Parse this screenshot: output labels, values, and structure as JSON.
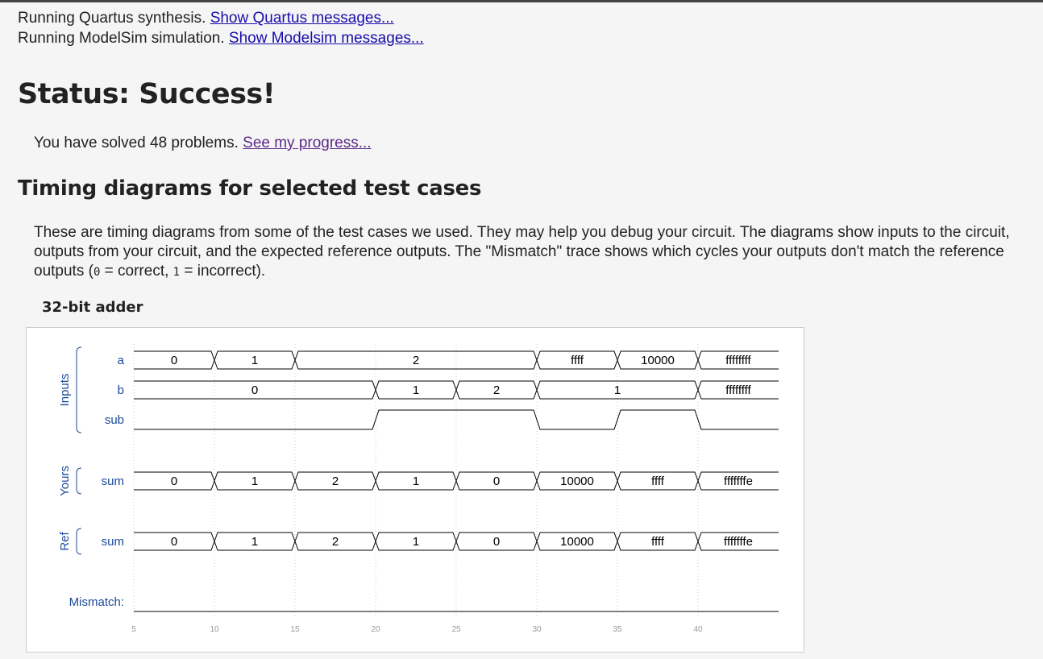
{
  "status_lines": [
    {
      "text": "Running Quartus synthesis. ",
      "link": "Show Quartus messages..."
    },
    {
      "text": "Running ModelSim simulation. ",
      "link": "Show Modelsim messages..."
    }
  ],
  "status_title": "Status: Success!",
  "progress": {
    "text": "You have solved 48 problems. ",
    "link": "See my progress..."
  },
  "section_title": "Timing diagrams for selected test cases",
  "description": {
    "part1": "These are timing diagrams from some of the test cases we used. They may help you debug your circuit. The diagrams show inputs to the circuit, outputs from your circuit, and the expected reference outputs. The \"Mismatch\" trace shows which cycles your outputs don't match the reference outputs (",
    "zero": "0",
    "part2": " = correct, ",
    "one": "1",
    "part3": " = incorrect)."
  },
  "diagram_title": "32-bit adder",
  "waveform": {
    "time_ticks": [
      5,
      10,
      15,
      20,
      25,
      30,
      35,
      40
    ],
    "time_range": [
      5,
      45
    ],
    "groups": [
      {
        "label": "Inputs",
        "signals": [
          "a",
          "b",
          "sub"
        ]
      },
      {
        "label": "Yours",
        "signals": [
          "sum"
        ]
      },
      {
        "label": "Ref",
        "signals": [
          "sum"
        ]
      }
    ],
    "mismatch_label": "Mismatch:",
    "colors": {
      "group_label": "#1a4a9a",
      "line": "#000000",
      "grid": "#cccccc"
    },
    "signals": [
      {
        "name": "a",
        "type": "bus",
        "segments": [
          {
            "start": 5,
            "end": 10,
            "value": "0"
          },
          {
            "start": 10,
            "end": 15,
            "value": "1"
          },
          {
            "start": 15,
            "end": 30,
            "value": "2"
          },
          {
            "start": 30,
            "end": 35,
            "value": "ffff"
          },
          {
            "start": 35,
            "end": 40,
            "value": "10000"
          },
          {
            "start": 40,
            "end": 45,
            "value": "ffffffff"
          }
        ]
      },
      {
        "name": "b",
        "type": "bus",
        "segments": [
          {
            "start": 5,
            "end": 20,
            "value": "0"
          },
          {
            "start": 20,
            "end": 25,
            "value": "1"
          },
          {
            "start": 25,
            "end": 30,
            "value": "2"
          },
          {
            "start": 30,
            "end": 40,
            "value": "1"
          },
          {
            "start": 40,
            "end": 45,
            "value": "ffffffff"
          }
        ]
      },
      {
        "name": "sub",
        "type": "bit",
        "transitions": [
          {
            "time": 5,
            "level": 0
          },
          {
            "time": 20,
            "level": 1
          },
          {
            "time": 30,
            "level": 0
          },
          {
            "time": 35,
            "level": 1
          },
          {
            "time": 40,
            "level": 0
          }
        ]
      },
      {
        "name": "sum",
        "type": "bus",
        "segments": [
          {
            "start": 5,
            "end": 10,
            "value": "0"
          },
          {
            "start": 10,
            "end": 15,
            "value": "1"
          },
          {
            "start": 15,
            "end": 20,
            "value": "2"
          },
          {
            "start": 20,
            "end": 25,
            "value": "1"
          },
          {
            "start": 25,
            "end": 30,
            "value": "0"
          },
          {
            "start": 30,
            "end": 35,
            "value": "10000"
          },
          {
            "start": 35,
            "end": 40,
            "value": "ffff"
          },
          {
            "start": 40,
            "end": 45,
            "value": "fffffffe"
          }
        ]
      },
      {
        "name": "sum",
        "type": "bus",
        "segments": [
          {
            "start": 5,
            "end": 10,
            "value": "0"
          },
          {
            "start": 10,
            "end": 15,
            "value": "1"
          },
          {
            "start": 15,
            "end": 20,
            "value": "2"
          },
          {
            "start": 20,
            "end": 25,
            "value": "1"
          },
          {
            "start": 25,
            "end": 30,
            "value": "0"
          },
          {
            "start": 30,
            "end": 35,
            "value": "10000"
          },
          {
            "start": 35,
            "end": 40,
            "value": "ffff"
          },
          {
            "start": 40,
            "end": 45,
            "value": "fffffffe"
          }
        ]
      },
      {
        "name": "Mismatch",
        "type": "bit",
        "transitions": [
          {
            "time": 5,
            "level": 0
          }
        ]
      }
    ]
  }
}
